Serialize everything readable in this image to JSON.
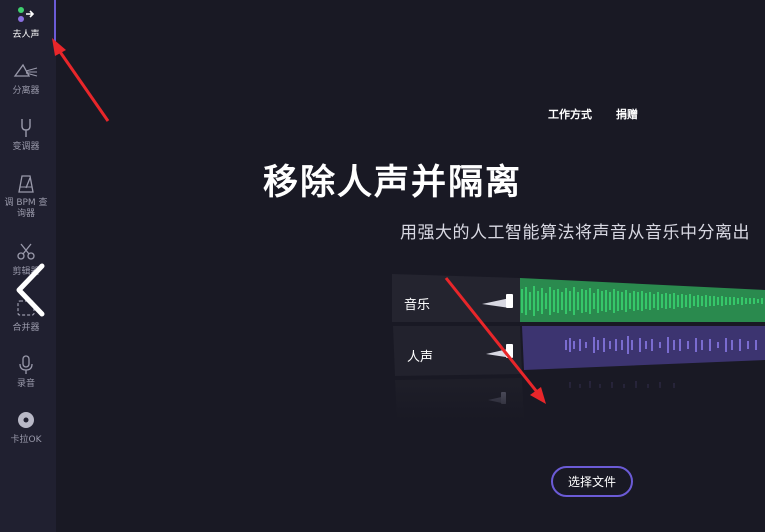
{
  "sidebar": {
    "items": [
      {
        "label": "去人声",
        "icon": "vocal-remover-icon",
        "active": true
      },
      {
        "label": "分离器",
        "icon": "splitter-icon"
      },
      {
        "label": "变调器",
        "icon": "tuning-fork-icon"
      },
      {
        "label": "调 BPM 查询器",
        "icon": "metronome-icon"
      },
      {
        "label": "剪辑器",
        "icon": "scissors-icon"
      },
      {
        "label": "合并器",
        "icon": "joiner-icon"
      },
      {
        "label": "录音",
        "icon": "microphone-icon"
      },
      {
        "label": "卡拉OK",
        "icon": "karaoke-icon"
      }
    ]
  },
  "nav": {
    "how_it_works": "工作方式",
    "donate": "捐赠"
  },
  "hero": {
    "title": "移除人声并隔离",
    "subtitle": "用强大的人工智能算法将声音从音乐中分离出"
  },
  "preview": {
    "tracks": [
      {
        "label": "音乐",
        "color": "#2fd36b"
      },
      {
        "label": "人声",
        "color": "#7b6ad8"
      }
    ]
  },
  "cta": {
    "select_file": "选择文件"
  },
  "colors": {
    "accent": "#6b5bd6",
    "annotation_arrow": "#e8262a",
    "background": "#191924"
  }
}
